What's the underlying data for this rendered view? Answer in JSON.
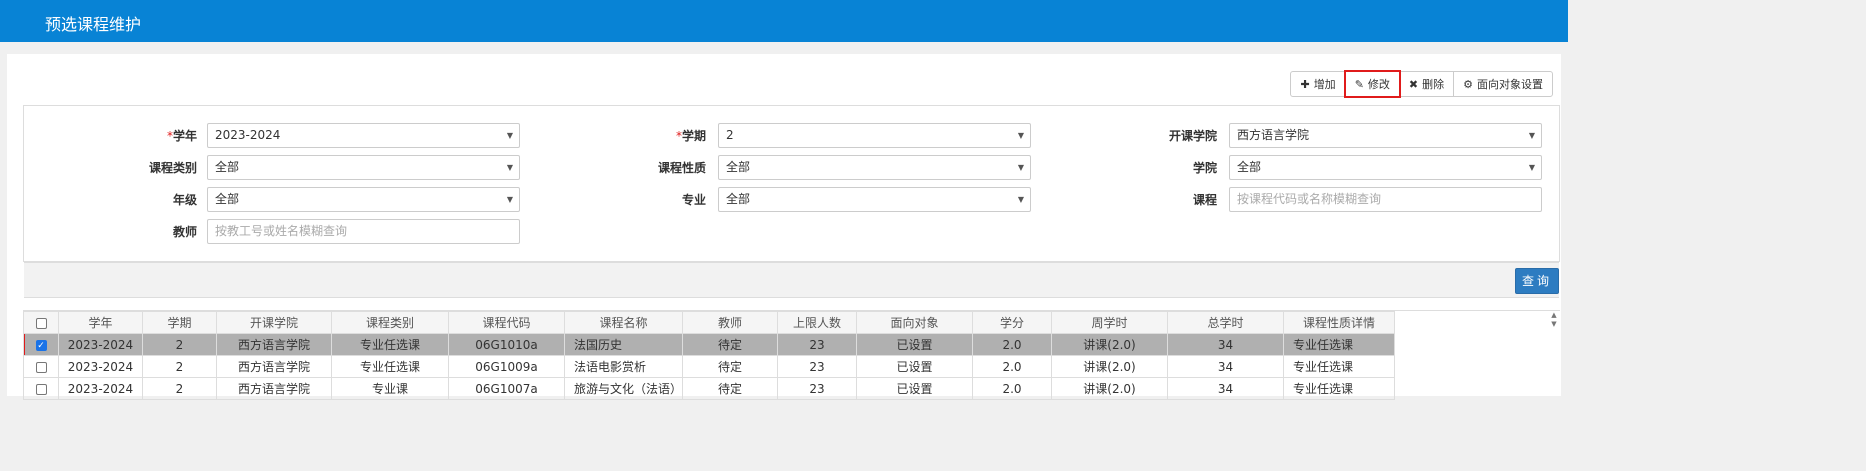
{
  "header": {
    "title": "预选课程维护"
  },
  "toolbar": {
    "add": {
      "icon": "plus-icon",
      "label": "增加"
    },
    "edit": {
      "icon": "edit-icon",
      "label": "修改"
    },
    "delete": {
      "icon": "close-icon",
      "label": "删除"
    },
    "target": {
      "icon": "gear-icon",
      "label": "面向对象设置"
    }
  },
  "form": {
    "year": {
      "label": "学年",
      "required": "*",
      "value": "2023-2024"
    },
    "term": {
      "label": "学期",
      "required": "*",
      "value": "2"
    },
    "college": {
      "label": "开课学院",
      "value": "西方语言学院"
    },
    "category": {
      "label": "课程类别",
      "value": "全部"
    },
    "nature": {
      "label": "课程性质",
      "value": "全部"
    },
    "school": {
      "label": "学院",
      "value": "全部"
    },
    "grade": {
      "label": "年级",
      "value": "全部"
    },
    "major": {
      "label": "专业",
      "value": "全部"
    },
    "course": {
      "label": "课程",
      "placeholder": "按课程代码或名称模糊查询"
    },
    "teacher": {
      "label": "教师",
      "placeholder": "按教工号或姓名模糊查询"
    },
    "query_label": "查询"
  },
  "table": {
    "headers": [
      "学年",
      "学期",
      "开课学院",
      "课程类别",
      "课程代码",
      "课程名称",
      "教师",
      "上限人数",
      "面向对象",
      "学分",
      "周学时",
      "总学时",
      "课程性质详情"
    ],
    "rows": [
      [
        "2023-2024",
        "2",
        "西方语言学院",
        "专业任选课",
        "06G1010a",
        "法国历史",
        "待定",
        "23",
        "已设置",
        "2.0",
        "讲课(2.0)",
        "34",
        "专业任选课"
      ],
      [
        "2023-2024",
        "2",
        "西方语言学院",
        "专业任选课",
        "06G1009a",
        "法语电影赏析",
        "待定",
        "23",
        "已设置",
        "2.0",
        "讲课(2.0)",
        "34",
        "专业任选课"
      ],
      [
        "2023-2024",
        "2",
        "西方语言学院",
        "专业课",
        "06G1007a",
        "旅游与文化（法语）",
        "待定",
        "23",
        "已设置",
        "2.0",
        "讲课(2.0)",
        "34",
        "专业任选课"
      ]
    ]
  }
}
